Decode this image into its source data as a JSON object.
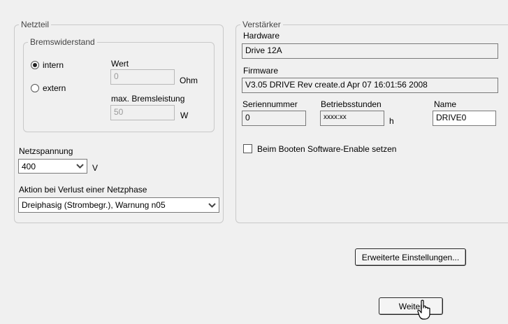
{
  "netzteil": {
    "title": "Netzteil",
    "bremswiderstand": {
      "title": "Bremswiderstand",
      "intern_label": "intern",
      "extern_label": "extern",
      "selected": "intern",
      "wert_label": "Wert",
      "wert_value": "0",
      "wert_unit": "Ohm",
      "leistung_label": "max. Bremsleistung",
      "leistung_value": "50",
      "leistung_unit": "W"
    },
    "netzspannung": {
      "label": "Netzspannung",
      "value": "400",
      "unit": "V"
    },
    "netzphase": {
      "label": "Aktion bei Verlust einer Netzphase",
      "value": "Dreiphasig (Strombegr.), Warnung n05"
    }
  },
  "verstaerker": {
    "title": "Verstärker",
    "hardware_label": "Hardware",
    "hardware_value": "Drive 12A",
    "firmware_label": "Firmware",
    "firmware_value": "V3.05 DRIVE Rev create.d Apr 07 16:01:56 2008",
    "seriennummer_label": "Seriennummer",
    "seriennummer_value": "0",
    "betriebsstunden_label": "Betriebsstunden",
    "betriebsstunden_value": "xxxx:xx",
    "betriebsstunden_unit": "h",
    "name_label": "Name",
    "name_value": "DRIVE0",
    "booten_label": "Beim Booten Software-Enable setzen",
    "booten_checked": false
  },
  "buttons": {
    "erweiterte": "Erweiterte Einstellungen...",
    "weiter": "Weiter"
  }
}
